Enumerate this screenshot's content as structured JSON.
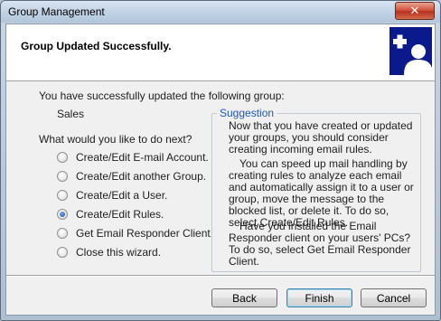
{
  "window": {
    "title": "Group Management",
    "close_glyph": "✕"
  },
  "header": {
    "title": "Group Updated Successfully.",
    "icon": "add-user-icon"
  },
  "body": {
    "intro": "You have successfully updated the following group:",
    "group_name": "Sales",
    "next_question": "What would you like to do next?",
    "options": [
      {
        "label": "Create/Edit E-mail Account.",
        "checked": false
      },
      {
        "label": "Create/Edit another Group.",
        "checked": false
      },
      {
        "label": "Create/Edit a User.",
        "checked": false
      },
      {
        "label": "Create/Edit Rules.",
        "checked": true
      },
      {
        "label": "Get Email Responder Client.",
        "checked": false
      },
      {
        "label": "Close this wizard.",
        "checked": false
      }
    ]
  },
  "suggestion": {
    "label": "Suggestion",
    "paragraphs": [
      "Now that you have created or updated your groups, you should consider creating incoming email rules.",
      "You can speed up mail handling by creating rules to analyze each email and automatically assign it to a user or group, move the message to the blocked list, or delete it. To do so, select Create/Edit Rules.",
      "Have you installed the Email Responder client on your users' PCs? To do so, select Get Email Responder Client."
    ]
  },
  "buttons": {
    "back": "Back",
    "finish": "Finish",
    "cancel": "Cancel"
  },
  "colors": {
    "header_icon_bg": "#0a1a8c",
    "suggestion_label": "#1e5ab4"
  }
}
